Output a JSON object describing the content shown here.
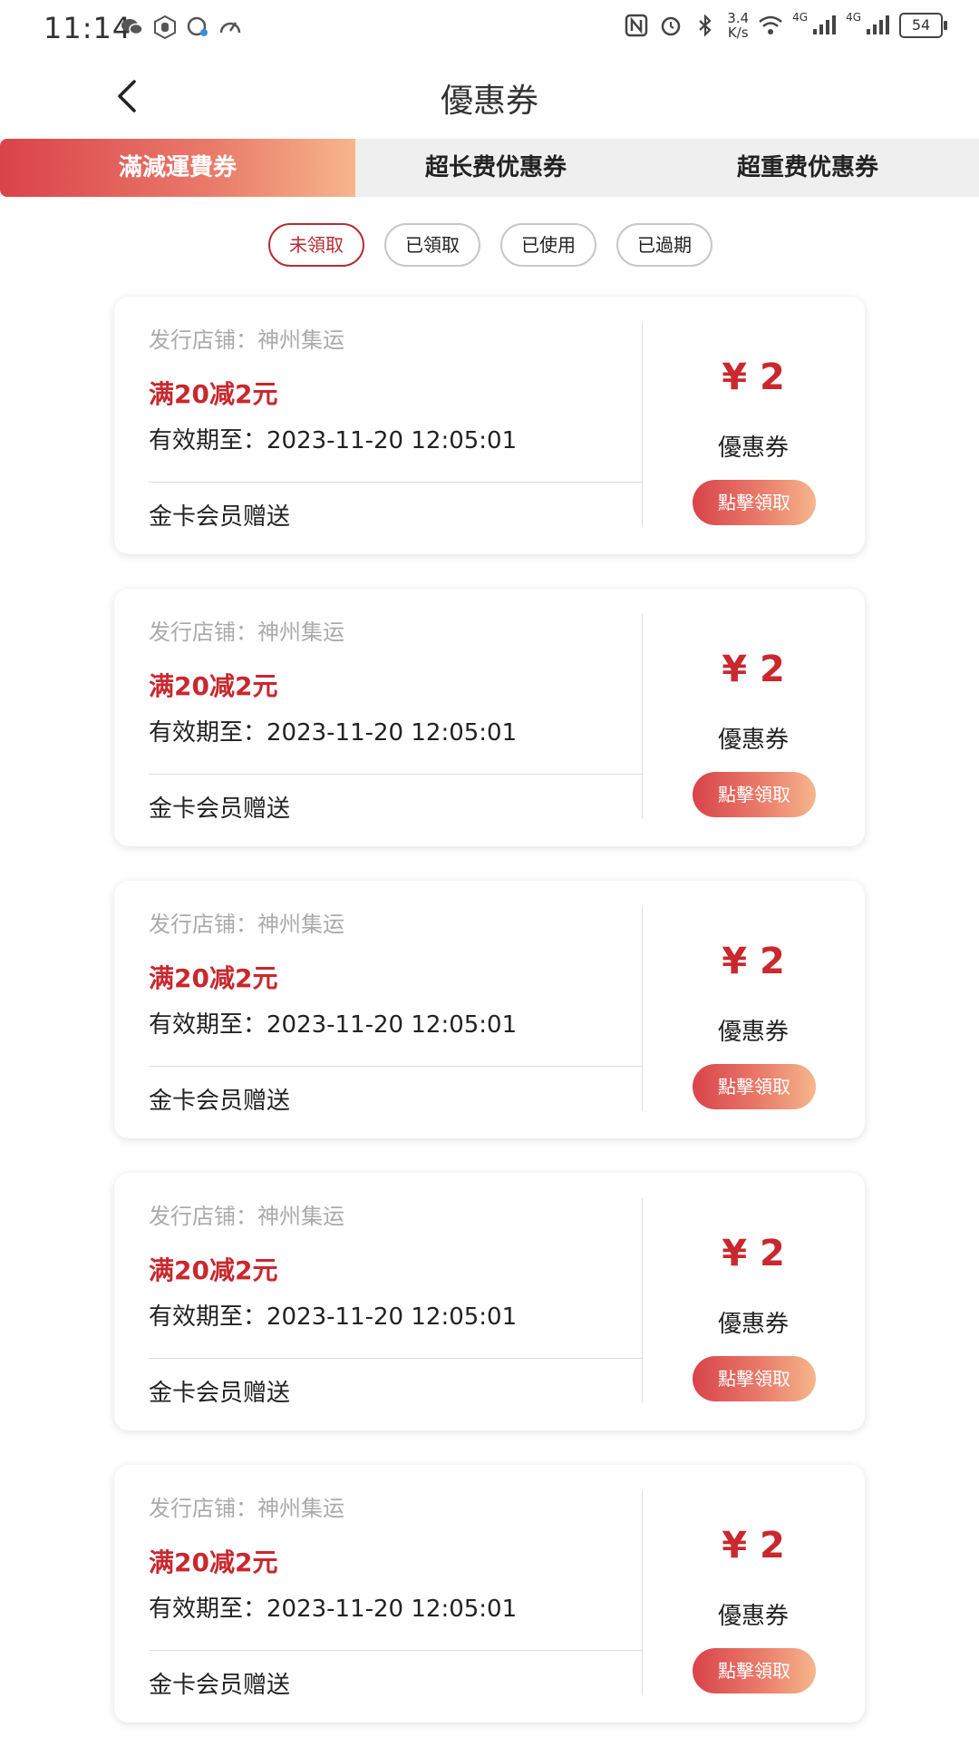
{
  "status_bar": {
    "time": "11:14",
    "net_speed_value": "3.4",
    "net_speed_unit": "K/s",
    "signal_label": "4G",
    "battery": "54"
  },
  "header": {
    "title": "優惠券"
  },
  "tabs": [
    {
      "label": "滿減運費券",
      "active": true
    },
    {
      "label": "超长费优惠券",
      "active": false
    },
    {
      "label": "超重费优惠券",
      "active": false
    }
  ],
  "filters": [
    {
      "label": "未領取",
      "active": true
    },
    {
      "label": "已領取",
      "active": false
    },
    {
      "label": "已使用",
      "active": false
    },
    {
      "label": "已過期",
      "active": false
    }
  ],
  "coupons": [
    {
      "store": "发行店铺：神州集运",
      "name": "满20减2元",
      "expire": "有效期至：2023-11-20 12:05:01",
      "gift": "金卡会员赠送",
      "amount": "¥ 2",
      "type": "優惠券",
      "button": "點擊領取"
    },
    {
      "store": "发行店铺：神州集运",
      "name": "满20减2元",
      "expire": "有效期至：2023-11-20 12:05:01",
      "gift": "金卡会员赠送",
      "amount": "¥ 2",
      "type": "優惠券",
      "button": "點擊領取"
    },
    {
      "store": "发行店铺：神州集运",
      "name": "满20减2元",
      "expire": "有效期至：2023-11-20 12:05:01",
      "gift": "金卡会员赠送",
      "amount": "¥ 2",
      "type": "優惠券",
      "button": "點擊領取"
    },
    {
      "store": "发行店铺：神州集运",
      "name": "满20减2元",
      "expire": "有效期至：2023-11-20 12:05:01",
      "gift": "金卡会员赠送",
      "amount": "¥ 2",
      "type": "優惠券",
      "button": "點擊領取"
    },
    {
      "store": "发行店铺：神州集运",
      "name": "满20减2元",
      "expire": "有效期至：2023-11-20 12:05:01",
      "gift": "金卡会员赠送",
      "amount": "¥ 2",
      "type": "優惠券",
      "button": "點擊領取"
    }
  ],
  "colors": {
    "accent": "#c8282e",
    "gradient_start": "#d9434a",
    "gradient_end": "#f6b68c"
  },
  "icons": {
    "back": "chevron-left-icon",
    "status_left": [
      "wechat-icon",
      "hand-icon",
      "chat-bubble-icon",
      "speedometer-icon"
    ],
    "status_right": [
      "nfc-icon",
      "alarm-icon",
      "bluetooth-icon",
      "wifi-icon",
      "signal-icon",
      "battery-icon"
    ]
  }
}
